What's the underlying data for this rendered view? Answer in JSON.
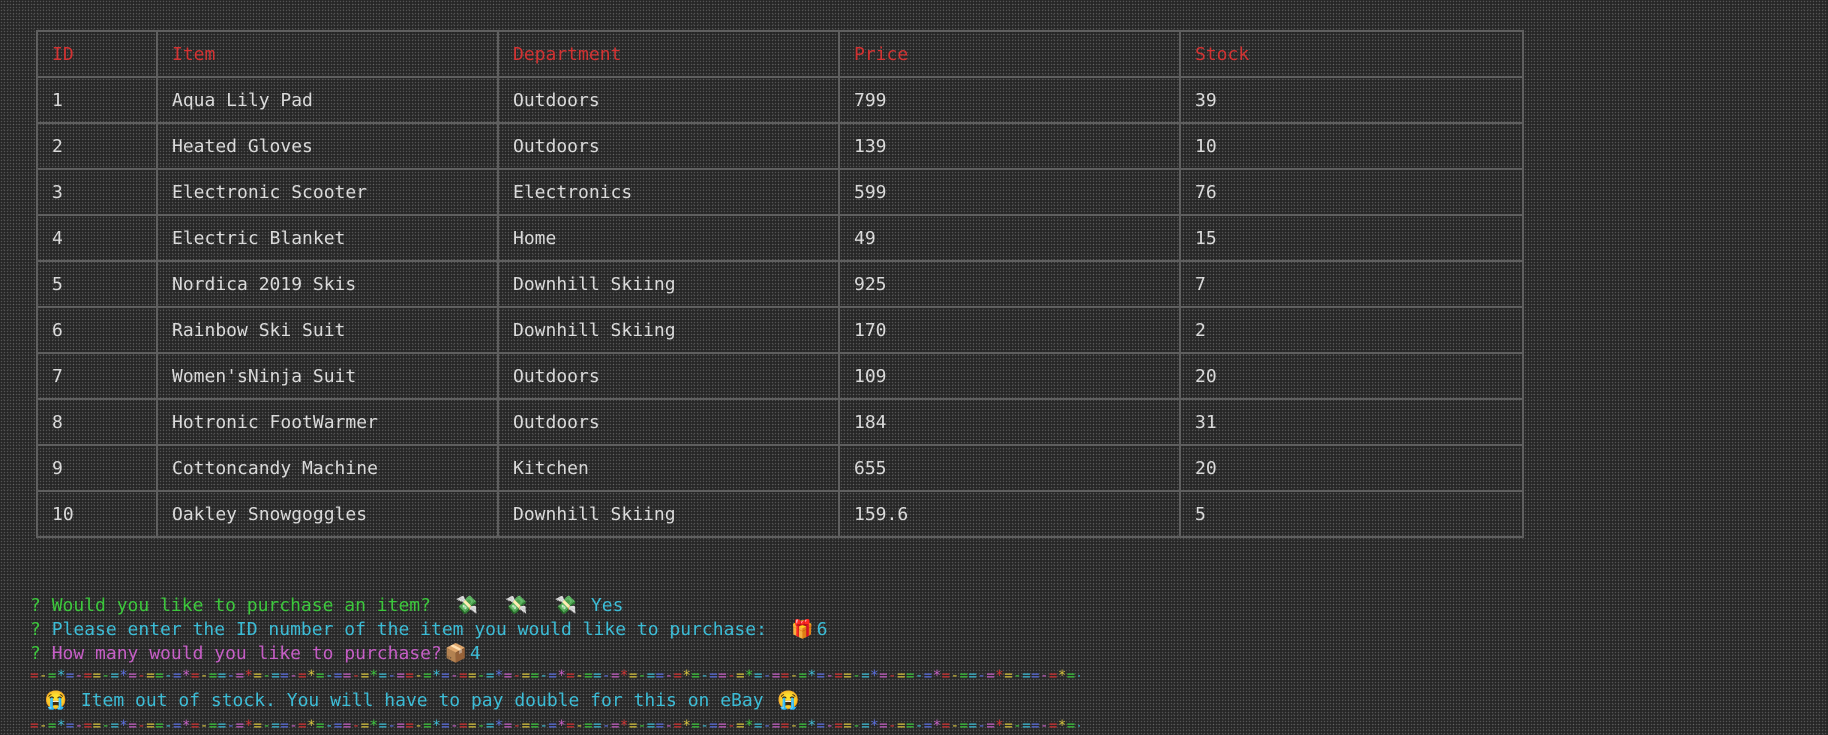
{
  "table": {
    "headers": [
      "ID",
      "Item",
      "Department",
      "Price",
      "Stock"
    ],
    "rows": [
      [
        "1",
        "Aqua Lily Pad",
        "Outdoors",
        "799",
        "39"
      ],
      [
        "2",
        "Heated Gloves",
        "Outdoors",
        "139",
        "10"
      ],
      [
        "3",
        "Electronic Scooter",
        "Electronics",
        "599",
        "76"
      ],
      [
        "4",
        "Electric Blanket",
        "Home",
        "49",
        "15"
      ],
      [
        "5",
        "Nordica 2019 Skis",
        "Downhill Skiing",
        "925",
        "7"
      ],
      [
        "6",
        "Rainbow Ski Suit",
        "Downhill Skiing",
        "170",
        "2"
      ],
      [
        "7",
        "Women'sNinja Suit",
        "Outdoors",
        "109",
        "20"
      ],
      [
        "8",
        "Hotronic FootWarmer",
        "Outdoors",
        "184",
        "31"
      ],
      [
        "9",
        "Cottoncandy Machine",
        "Kitchen",
        "655",
        "20"
      ],
      [
        "10",
        "Oakley Snowgoggles",
        "Downhill Skiing",
        "159.6",
        "5"
      ]
    ]
  },
  "prompts": {
    "q_mark": "?",
    "purchase_question": "Would you like to purchase an item?",
    "purchase_icons": [
      "💸",
      "💸",
      "💸"
    ],
    "purchase_answer": "Yes",
    "id_question": "Please enter the ID number of the item you would like to purchase:",
    "id_icon": "🎁",
    "id_answer": "6",
    "qty_question": "How many would you like to purchase?",
    "qty_icon": "📦",
    "qty_answer": "4"
  },
  "message": {
    "icon": "😭",
    "text": "Item out of stock. You will have to pay double for this on eBay"
  }
}
